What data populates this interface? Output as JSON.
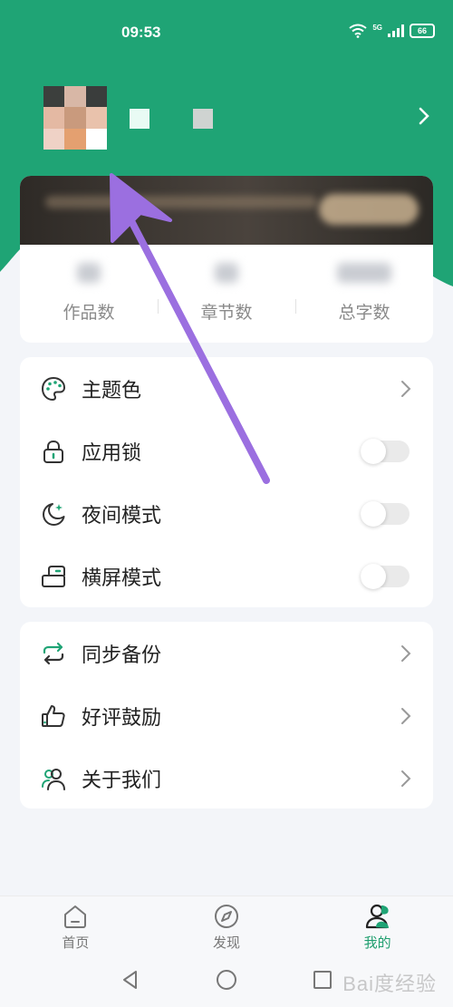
{
  "status_bar": {
    "time": "09:53",
    "network": "5G",
    "battery": "66"
  },
  "colors": {
    "accent": "#1fa475",
    "tab_active": "#1e9e6e",
    "annotation_arrow": "#9b6fe0"
  },
  "stats": [
    {
      "label": "作品数"
    },
    {
      "label": "章节数"
    },
    {
      "label": "总字数"
    }
  ],
  "settings": [
    {
      "label": "主题色",
      "icon": "palette-icon",
      "control": "chevron"
    },
    {
      "label": "应用锁",
      "icon": "lock-icon",
      "control": "toggle",
      "on": false
    },
    {
      "label": "夜间模式",
      "icon": "moon-icon",
      "control": "toggle",
      "on": false
    },
    {
      "label": "横屏模式",
      "icon": "rotate-screen-icon",
      "control": "toggle",
      "on": false
    }
  ],
  "more": [
    {
      "label": "同步备份",
      "icon": "sync-icon",
      "control": "chevron"
    },
    {
      "label": "好评鼓励",
      "icon": "thumbs-up-icon",
      "control": "chevron"
    },
    {
      "label": "关于我们",
      "icon": "users-icon",
      "control": "chevron"
    }
  ],
  "tabs": [
    {
      "label": "首页",
      "icon": "home-icon",
      "active": false
    },
    {
      "label": "发现",
      "icon": "compass-icon",
      "active": false
    },
    {
      "label": "我的",
      "icon": "profile-icon",
      "active": true
    }
  ],
  "watermark": "Bai度经验"
}
